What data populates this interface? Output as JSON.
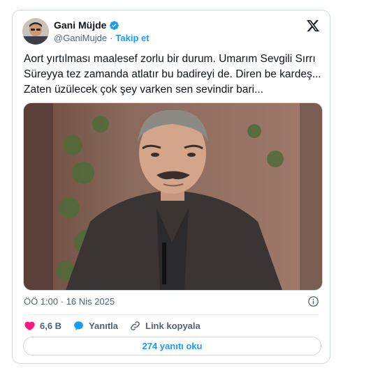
{
  "author": {
    "display_name": "Gani Müjde",
    "handle": "@GaniMujde",
    "separator": "·",
    "follow_label": "Takip et"
  },
  "tweet": {
    "text": "Aort yırtılması maalesef zorlu bir durum. Umarım Sevgili Sırrı Süreyya tez zamanda atlatır bu badireyi de. Diren be kardeş... Zaten üzülecek çok şey varken sen sevindir bari...",
    "timestamp": "ÖÖ 1:00 · 16 Nis 2025"
  },
  "actions": {
    "likes": "6,6 B",
    "reply_label": "Yanıtla",
    "copy_link_label": "Link kopyala"
  },
  "replies_button": "274 yanıtı oku",
  "colors": {
    "accent": "#1d9bf0",
    "like": "#f91880",
    "text": "#0f1419",
    "secondary": "#536471",
    "border": "#cfd9de"
  },
  "icons": [
    "verified-badge-icon",
    "x-logo-icon",
    "info-icon",
    "heart-icon",
    "reply-bubble-icon",
    "link-icon"
  ]
}
